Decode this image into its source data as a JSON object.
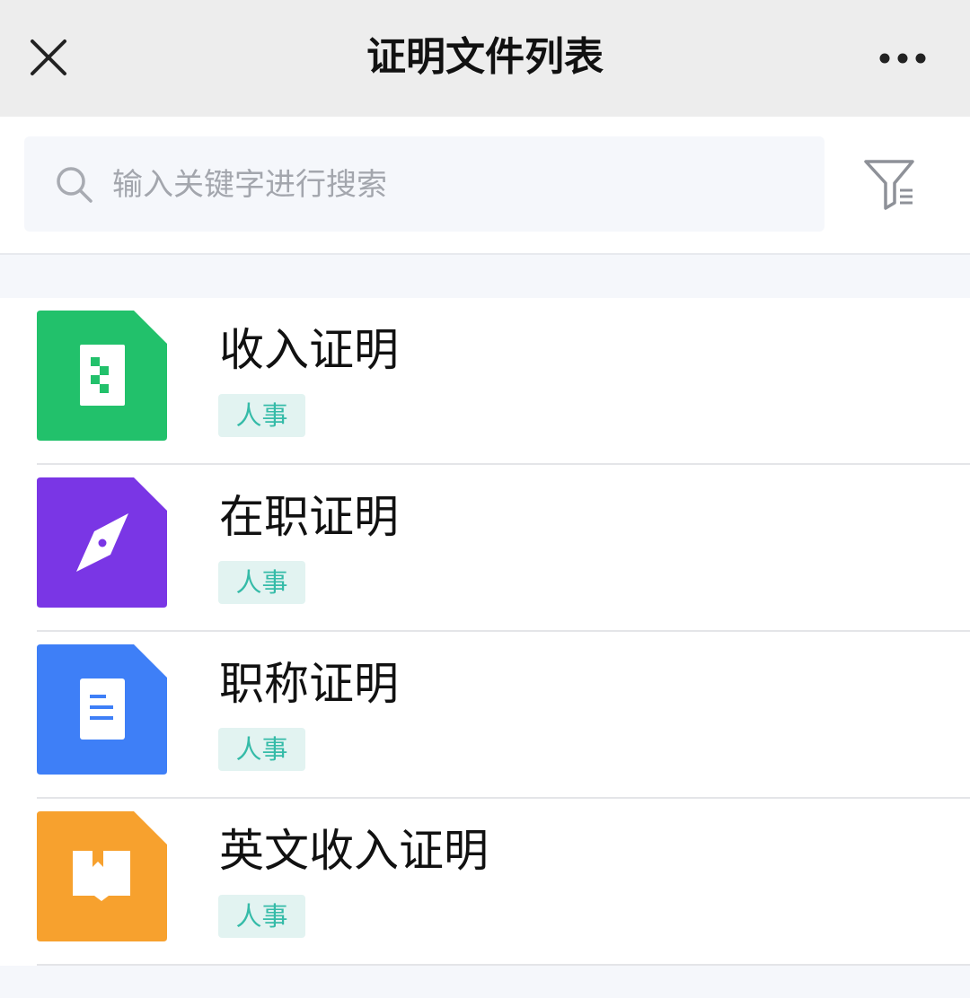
{
  "header": {
    "title": "证明文件列表",
    "close_icon": "close-icon",
    "more_icon": "more-horizontal-icon"
  },
  "search": {
    "placeholder": "输入关键字进行搜索",
    "value": "",
    "icon": "search-icon",
    "filter_icon": "filter-icon"
  },
  "list": {
    "items": [
      {
        "title": "收入证明",
        "tag": "人事",
        "icon": "spreadsheet-file-icon",
        "color": "#22c16b"
      },
      {
        "title": "在职证明",
        "tag": "人事",
        "icon": "compass-file-icon",
        "color": "#7a36e5"
      },
      {
        "title": "职称证明",
        "tag": "人事",
        "icon": "document-file-icon",
        "color": "#3e7ff7"
      },
      {
        "title": "英文收入证明",
        "tag": "人事",
        "icon": "book-file-icon",
        "color": "#f7a12e"
      }
    ]
  },
  "colors": {
    "header_bg": "#ededed",
    "page_bg": "#f5f7fb",
    "tag_bg": "#e2f3f1",
    "tag_text": "#35bba8"
  }
}
